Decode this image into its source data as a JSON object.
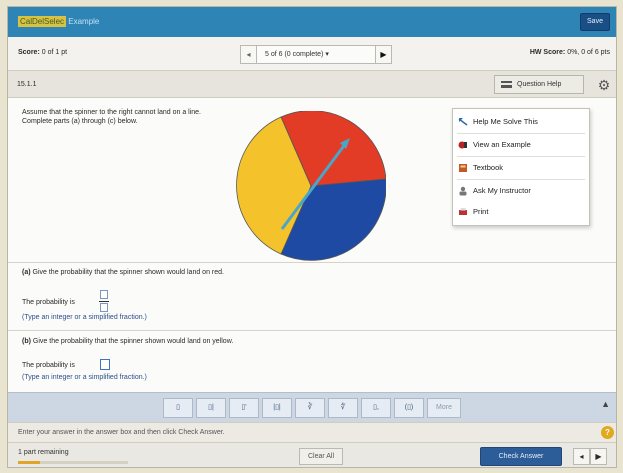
{
  "header": {
    "title_highlight": "CalDelSelec",
    "title_rest": " Example",
    "save_label": "Save"
  },
  "scorebar": {
    "score_label": "Score:",
    "score_value": "0 of 1 pt",
    "pager_prev": "◂",
    "pager_text": "5 of 6 (0 complete)",
    "pager_caret": "▾",
    "pager_next": "▶",
    "hw_label": "HW Score:",
    "hw_value": "0%, 0 of 6 pts"
  },
  "question_bar": {
    "number": "15.1.1",
    "help_label": "Question Help",
    "settings_icon": "gear-icon"
  },
  "question": {
    "prompt": "Assume that the spinner to the right cannot land on a line. Complete parts (a) through (c) below.",
    "part_a_tag": "(a)",
    "part_a_text": "Give the probability that the spinner shown would land on red.",
    "part_a_label": "The probability is",
    "part_a_hint": "(Type an integer or a simplified fraction.)",
    "part_b_tag": "(b)",
    "part_b_text": "Give the probability that the spinner shown would land on yellow.",
    "part_b_label": "The probability is",
    "part_b_hint": "(Type an integer or a simplified fraction.)"
  },
  "spinner": {
    "colors": {
      "red": "#e23b26",
      "yellow": "#f4c32c",
      "blue": "#1f4aa3",
      "arrow": "#4aa6c9"
    }
  },
  "help_menu": {
    "items": [
      {
        "label": "Help Me Solve This",
        "icon": "help-me-solve-icon"
      },
      {
        "label": "View an Example",
        "icon": "example-icon"
      },
      {
        "label": "Textbook",
        "icon": "textbook-icon"
      },
      {
        "label": "Ask My Instructor",
        "icon": "ask-instructor-icon"
      },
      {
        "label": "Print",
        "icon": "print-icon"
      }
    ]
  },
  "math_toolbar": {
    "tools": [
      "▯",
      "▯|",
      "▯'",
      "|▯|",
      "∛",
      "∜",
      "▯,",
      "(▯)",
      "More"
    ],
    "collapse_icon": "▲"
  },
  "instruction": {
    "text": "Enter your answer in the answer box and then click Check Answer.",
    "help_icon_text": "?"
  },
  "footer": {
    "remaining": "1 part remaining",
    "progress": 0.2,
    "clear_all": "Clear All",
    "check_answer": "Check Answer",
    "nav_prev": "◂",
    "nav_next": "▶"
  }
}
